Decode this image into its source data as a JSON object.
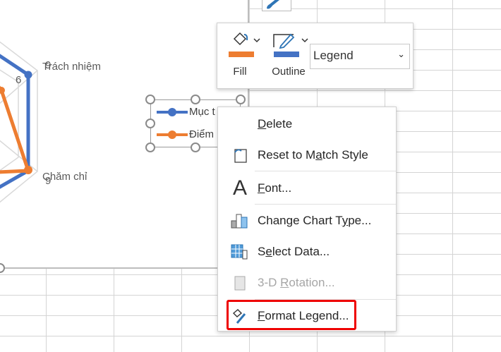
{
  "chart": {
    "axis_labels": [
      "Trách nhiệm",
      "Chăm chỉ"
    ],
    "tick_labels": [
      "6",
      "9",
      "9"
    ],
    "legend": {
      "items": [
        {
          "label": "Mục t",
          "color": "#4472c4"
        },
        {
          "label": "Điểm",
          "color": "#ed7d31"
        }
      ]
    }
  },
  "mini_toolbar": {
    "fill_label": "Fill",
    "fill_color": "#ed7d31",
    "outline_label": "Outline",
    "outline_color": "#4472c4",
    "element_select": "Legend"
  },
  "context_menu": {
    "items": [
      {
        "pre": "",
        "u": "D",
        "post": "elete",
        "enabled": true
      },
      {
        "pre": "Reset to M",
        "u": "a",
        "post": "tch Style",
        "enabled": true
      },
      {
        "pre": "",
        "u": "F",
        "post": "ont...",
        "enabled": true
      },
      {
        "pre": "Change Chart T",
        "u": "y",
        "post": "pe...",
        "enabled": true
      },
      {
        "pre": "S",
        "u": "e",
        "post": "lect Data...",
        "enabled": true
      },
      {
        "pre": "3-D ",
        "u": "R",
        "post": "otation...",
        "enabled": false
      },
      {
        "pre": "",
        "u": "F",
        "post": "ormat Legend...",
        "enabled": true
      }
    ]
  }
}
